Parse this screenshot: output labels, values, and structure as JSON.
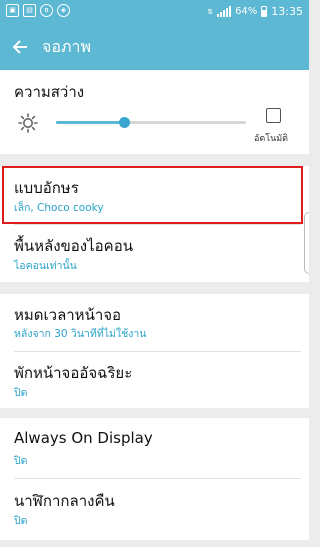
{
  "status": {
    "battery": "64%",
    "time": "13:35"
  },
  "header": {
    "title": "จอภาพ"
  },
  "brightness": {
    "title": "ความสว่าง",
    "auto_label": "อัตโนมัติ",
    "level": 0.36
  },
  "font_style": {
    "title": "แบบอักษร",
    "value": "เล็ก, Choco cooky"
  },
  "icon_bg": {
    "title": "พื้นหลังของไอคอน",
    "value": "ไอคอนเท่านั้น"
  },
  "timeout": {
    "title": "หมดเวลาหน้าจอ",
    "value": "หลังจาก 30 วินาทีที่ไม่ใช้งาน"
  },
  "daydream": {
    "title": "พักหน้าจออัจฉริยะ",
    "value": "ปิด"
  },
  "aod": {
    "title": "Always On Display",
    "value": "ปิด"
  },
  "night_clock": {
    "title": "นาฬิกากลางคืน",
    "value": "ปิด"
  }
}
